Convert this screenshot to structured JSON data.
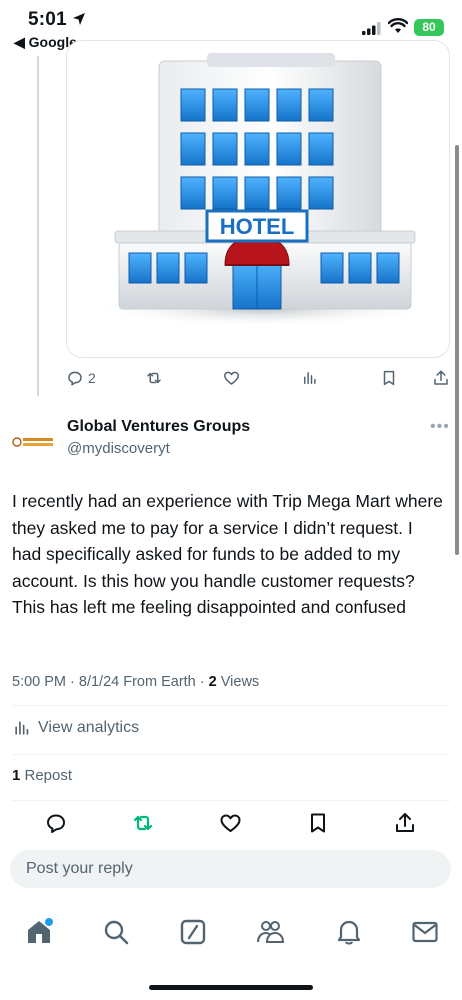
{
  "status_bar": {
    "time": "5:01",
    "back_app": "◀ Google",
    "battery": "80"
  },
  "previous_tweet": {
    "media_alt_icon": "hotel-building-image",
    "sign_text": "HOTEL",
    "reply_count": "2"
  },
  "tweet": {
    "author_name": "Global Ventures Groups",
    "author_handle": "@mydiscoveryt",
    "text": "I recently had an experience with Trip Mega Mart where they asked me to pay for a service I didn’t request. I had specifically asked for funds to be added to my account. Is this how you handle customer requests? This has left me feeling disappointed and confused",
    "timestamp": "5:00 PM · 8/1/24 From Earth · ",
    "views_count": "2",
    "views_label": " Views",
    "analytics_label": "View analytics",
    "repost_count": "1",
    "repost_label": " Repost"
  },
  "reply": {
    "placeholder": "Post your reply"
  },
  "colors": {
    "accent": "#1d9bf0",
    "repost_green": "#00ba7c",
    "text_secondary": "#536471",
    "battery_green": "#34c759"
  },
  "tabbar": {
    "items": [
      "home-icon",
      "search-icon",
      "grok-icon",
      "communities-icon",
      "notifications-icon",
      "messages-icon"
    ]
  }
}
